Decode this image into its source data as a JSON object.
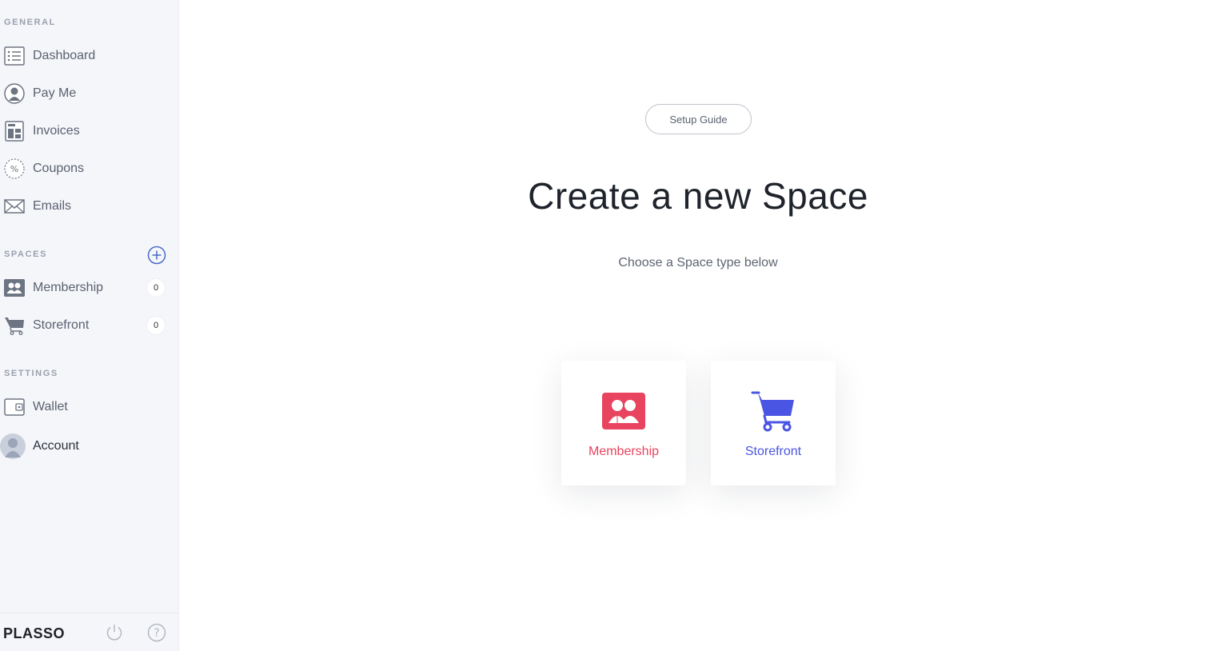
{
  "sidebar": {
    "sections": {
      "general": "GENERAL",
      "spaces": "SPACES",
      "settings": "SETTINGS"
    },
    "general_items": [
      {
        "label": "Dashboard",
        "icon": "list-icon"
      },
      {
        "label": "Pay Me",
        "icon": "user-icon"
      },
      {
        "label": "Invoices",
        "icon": "invoice-icon"
      },
      {
        "label": "Coupons",
        "icon": "percent-icon"
      },
      {
        "label": "Emails",
        "icon": "envelope-icon"
      }
    ],
    "space_items": [
      {
        "label": "Membership",
        "icon": "membership-icon",
        "count": "0"
      },
      {
        "label": "Storefront",
        "icon": "cart-icon",
        "count": "0"
      }
    ],
    "settings_items": [
      {
        "label": "Wallet",
        "icon": "wallet-icon"
      },
      {
        "label": "Account",
        "icon": "avatar-icon"
      }
    ],
    "footer": {
      "logo": "PLASSO"
    }
  },
  "main": {
    "setup_button": "Setup Guide",
    "title": "Create a new Space",
    "subtitle": "Choose a Space type below",
    "cards": [
      {
        "label": "Membership",
        "color": "#e8445f"
      },
      {
        "label": "Storefront",
        "color": "#4b55e3"
      }
    ]
  },
  "colors": {
    "sidebar_bg": "#f5f6fa",
    "icon_gray": "#6d7482",
    "accent_blue": "#4a6bc8"
  }
}
